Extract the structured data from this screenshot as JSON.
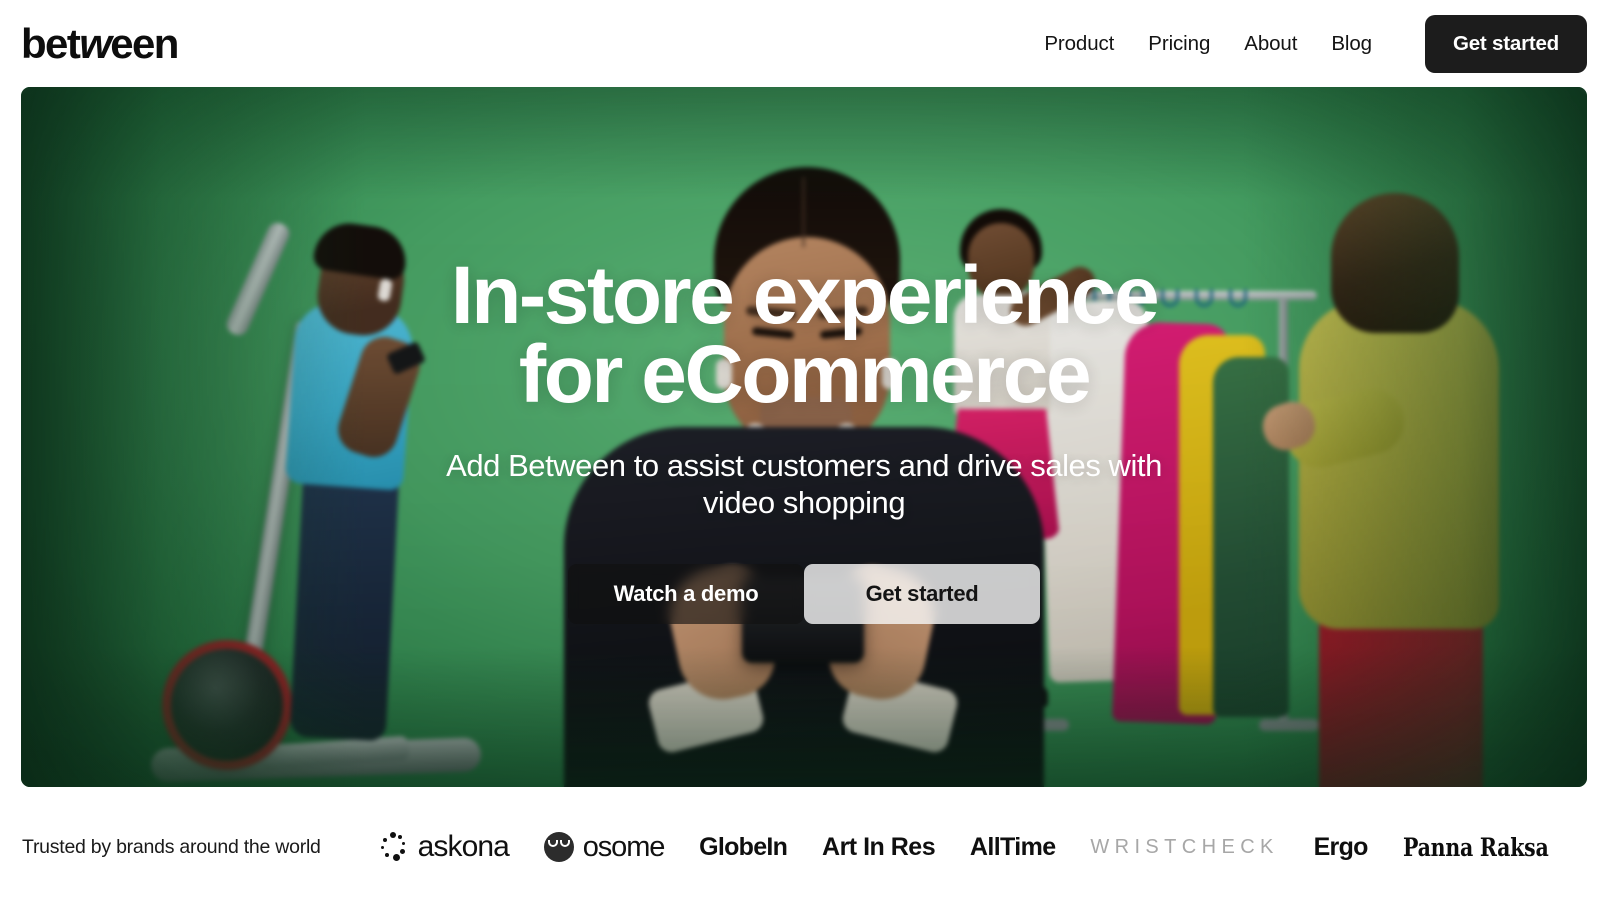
{
  "brand": {
    "logo_pre": "bet",
    "logo_italic": "w",
    "logo_post": "een",
    "logo_full": "between"
  },
  "nav": {
    "links": [
      {
        "label": "Product"
      },
      {
        "label": "Pricing"
      },
      {
        "label": "About"
      },
      {
        "label": "Blog"
      }
    ],
    "cta_label": "Get started"
  },
  "hero": {
    "title_line1": "In-store experience",
    "title_line2": "for eCommerce",
    "subtitle": "Add Between to assist customers and drive sales with video shopping",
    "primary_button": "Watch a demo",
    "secondary_button": "Get started",
    "background_description": "Green screen studio scene with shoppers, clothing rack and exercise machine",
    "scene_green": "#4aa868"
  },
  "trust": {
    "label": "Trusted by brands around the world",
    "logos": [
      {
        "name": "askona",
        "label": "askona",
        "icon": "askona-dots-icon",
        "style": "regular"
      },
      {
        "name": "osome",
        "label": "osome",
        "icon": "osome-face-icon",
        "style": "regular"
      },
      {
        "name": "globein",
        "label": "GlobeIn",
        "style": "bold"
      },
      {
        "name": "art-in-res",
        "label": "Art In Res",
        "style": "bold"
      },
      {
        "name": "alltime",
        "label": "AllTime",
        "style": "bold"
      },
      {
        "name": "wristcheck",
        "label": "WRISTCHECK",
        "style": "spaced-grey"
      },
      {
        "name": "ergo",
        "label": "Ergo",
        "style": "bold"
      },
      {
        "name": "panna-raksa",
        "label": "Panna Raksa",
        "style": "condensed-slab"
      }
    ]
  },
  "colors": {
    "cta_dark": "#1c1c1c",
    "text_dark": "#141414",
    "page_bg": "#ffffff",
    "wristcheck_grey": "#a7a7a7"
  }
}
